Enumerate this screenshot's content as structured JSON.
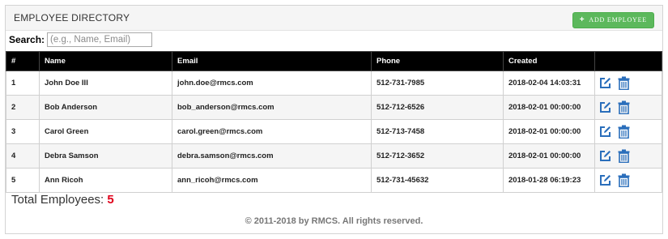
{
  "header": {
    "title": "EMPLOYEE DIRECTORY",
    "add_button_label": "ADD EMPLOYEE"
  },
  "search": {
    "label": "Search:",
    "placeholder": "(e.g., Name, Email)",
    "value": ""
  },
  "table": {
    "columns": [
      "#",
      "Name",
      "Email",
      "Phone",
      "Created",
      ""
    ],
    "rows": [
      {
        "id": "1",
        "name": "John Doe III",
        "email": "john.doe@rmcs.com",
        "phone": "512-731-7985",
        "created": "2018-02-04 14:03:31"
      },
      {
        "id": "2",
        "name": "Bob Anderson",
        "email": "bob_anderson@rmcs.com",
        "phone": "512-712-6526",
        "created": "2018-02-01 00:00:00"
      },
      {
        "id": "3",
        "name": "Carol Green",
        "email": "carol.green@rmcs.com",
        "phone": "512-713-7458",
        "created": "2018-02-01 00:00:00"
      },
      {
        "id": "4",
        "name": "Debra Samson",
        "email": "debra.samson@rmcs.com",
        "phone": "512-712-3652",
        "created": "2018-02-01 00:00:00"
      },
      {
        "id": "5",
        "name": "Ann Ricoh",
        "email": "ann_ricoh@rmcs.com",
        "phone": "512-731-45632",
        "created": "2018-01-28 06:19:23"
      }
    ],
    "row_actions": {
      "edit_icon": "edit-icon",
      "delete_icon": "trash-icon"
    }
  },
  "summary": {
    "label": "Total Employees:",
    "count": "5"
  },
  "footer": {
    "text": "© 2011-2018 by RMCS. All rights reserved."
  },
  "colors": {
    "accent": "#5cb85c",
    "header_bg": "#000000",
    "icon_blue": "#2a6ebb",
    "count_red": "#e0001a"
  }
}
